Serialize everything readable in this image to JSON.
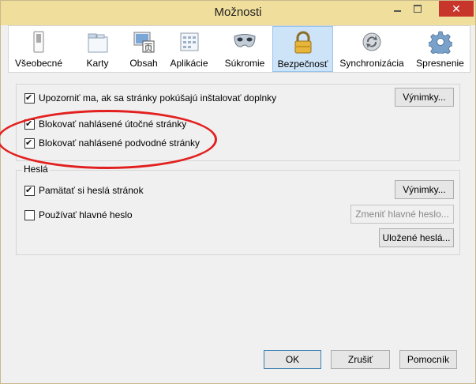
{
  "window": {
    "title": "Možnosti"
  },
  "tabs": [
    {
      "label": "Všeobecné",
      "icon": "switch-icon"
    },
    {
      "label": "Karty",
      "icon": "tabs-icon"
    },
    {
      "label": "Obsah",
      "icon": "content-icon"
    },
    {
      "label": "Aplikácie",
      "icon": "applications-icon"
    },
    {
      "label": "Súkromie",
      "icon": "privacy-mask-icon"
    },
    {
      "label": "Bezpečnosť",
      "icon": "padlock-icon"
    },
    {
      "label": "Synchronizácia",
      "icon": "sync-icon"
    },
    {
      "label": "Spresnenie",
      "icon": "gear-icon"
    }
  ],
  "active_tab": "Bezpečnosť",
  "general": {
    "warn_addons": "Upozorniť ma, ak sa stránky pokúšajú inštalovať doplnky",
    "block_attack": "Blokovať nahlásené útočné stránky",
    "block_forgery": "Blokovať nahlásené podvodné stránky",
    "exceptions_btn": "Výnimky..."
  },
  "passwords": {
    "legend": "Heslá",
    "remember": "Pamätať si heslá stránok",
    "master": "Používať hlavné heslo",
    "exceptions_btn": "Výnimky...",
    "change_master_btn": "Zmeniť hlavné heslo...",
    "saved_btn": "Uložené heslá..."
  },
  "footer": {
    "ok": "OK",
    "cancel": "Zrušiť",
    "help": "Pomocník"
  },
  "colors": {
    "titlebar": "#f0de9c",
    "annotation_ellipse": "#e2201f",
    "active_tab": "#cde3f7"
  }
}
